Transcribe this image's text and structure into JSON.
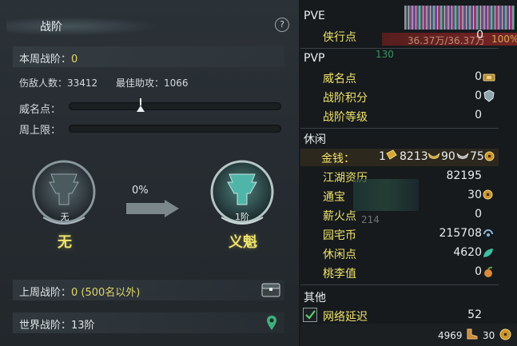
{
  "left": {
    "title": "战阶",
    "help": "?",
    "week_rank_label": "本周战阶：",
    "week_rank_value": "0",
    "kills_label": "伤敌人数：",
    "kills_value": "33412",
    "assists_label": "最佳助攻：",
    "assists_value": "1066",
    "fame_label": "威名点：",
    "fame_progress": 0.34,
    "week_limit_label": "周上限：",
    "current_rank_small": "无",
    "current_rank_name": "无",
    "progress_pct": "0%",
    "next_rank_small": "1阶",
    "next_rank_name": "义魁",
    "last_week_label": "上周战阶：",
    "last_week_value": "0 (500名以外)",
    "world_rank_label": "世界战阶：",
    "world_rank_value": "13阶",
    "icons": {
      "chest": "chest-icon",
      "map_pin": "map-pin-icon"
    }
  },
  "right": {
    "top_overlay_count": "130",
    "hp_text": "36.37万/36.37万",
    "hp_pct_overlay": "100%",
    "pve_header": "PVE",
    "xiaxing_label": "侠行点",
    "xiaxing_value": "0",
    "pvp_header": "PVP",
    "weiming_label": "威名点",
    "weiming_value": "0",
    "zhanjie_score_label": "战阶积分",
    "zhanjie_score_value": "0",
    "zhanjie_level_label": "战阶等级",
    "zhanjie_level_value": "0",
    "leisure_header": "休闲",
    "money_label": "金钱：",
    "money_gold": "1",
    "money_silver": "8213",
    "money_copper": "90",
    "money_extra": "75",
    "jianghu_label": "江湖资历",
    "jianghu_value": "82195",
    "tongbao_label": "通宝",
    "tongbao_value": "30",
    "xinhuo_label": "薪火点",
    "xinhuo_value": "0",
    "xinhuo_overlay": "214",
    "yuanzhai_label": "园宅币",
    "yuanzhai_value": "215708",
    "xiuxian_label": "休闲点",
    "xiuxian_value": "4620",
    "taoli_label": "桃李值",
    "taoli_value": "0",
    "other_header": "其他",
    "latency_label": "网络延迟",
    "latency_value": "52",
    "latency_checked": true,
    "footer_left": "4969",
    "footer_right": "30"
  },
  "colors": {
    "accent_yellow": "#f0e36b",
    "panel_bg": "#262c31",
    "right_bg": "#161a1d",
    "text": "#d7dcdf"
  }
}
